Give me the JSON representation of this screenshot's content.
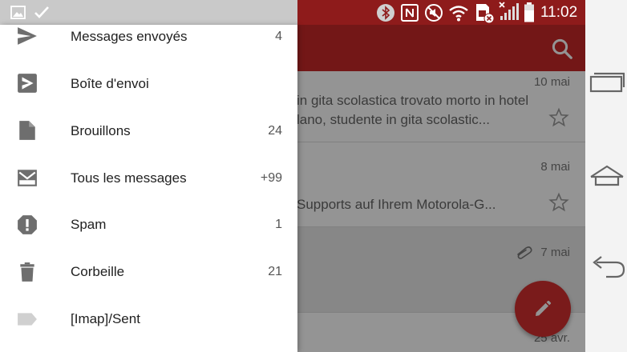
{
  "status_bar": {
    "time": "11:02",
    "left_icons": [
      "image-icon",
      "check-icon"
    ],
    "right_icons": [
      "bluetooth-icon",
      "nfc-icon",
      "mute-icon",
      "wifi-icon",
      "sim-icon",
      "signal-icon",
      "battery-icon"
    ]
  },
  "inbox": {
    "rows": [
      {
        "date": "10 mai",
        "line1": "in gita scolastica trovato morto in hotel",
        "line2": "lano, studente in gita scolastic...",
        "shaded": false
      },
      {
        "date": "8 mai",
        "line1": "",
        "line2": "Supports auf Ihrem Motorola-G...",
        "shaded": false
      },
      {
        "date": "7 mai",
        "line1": "",
        "line2": "",
        "shaded": true,
        "attachment": true
      },
      {
        "date": "25 avr.",
        "line1": "",
        "line2": "",
        "shaded": false
      }
    ]
  },
  "drawer": {
    "items": [
      {
        "label": "Messages envoyés",
        "count": "4",
        "icon": "send-icon"
      },
      {
        "label": "Boîte d'envoi",
        "count": "",
        "icon": "outbox-icon"
      },
      {
        "label": "Brouillons",
        "count": "24",
        "icon": "draft-icon"
      },
      {
        "label": "Tous les messages",
        "count": "+99",
        "icon": "all-mail-icon"
      },
      {
        "label": "Spam",
        "count": "1",
        "icon": "spam-icon"
      },
      {
        "label": "Corbeille",
        "count": "21",
        "icon": "trash-icon"
      },
      {
        "label": "[Imap]/Sent",
        "count": "",
        "icon": "label-icon"
      }
    ]
  },
  "colors": {
    "appbar": "#c62828",
    "fab": "#d32f2f",
    "icon_gray": "#757575"
  },
  "nav_buttons": [
    "recent-apps-icon",
    "home-icon",
    "back-icon"
  ]
}
